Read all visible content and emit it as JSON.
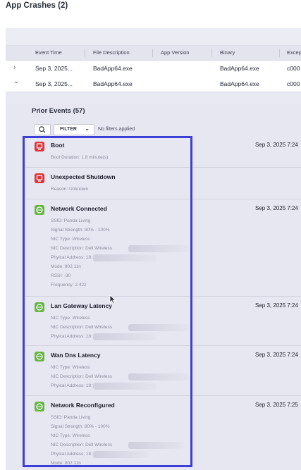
{
  "page": {
    "title": "App Crashes (2)"
  },
  "table": {
    "columns": [
      "Event Time",
      "File Description",
      "App Version",
      "Binary",
      "Excep"
    ],
    "rows": [
      {
        "chevron": "›",
        "event_time": "Sep 3, 2025...",
        "file_description": "BadApp64.exe",
        "app_version": "",
        "binary": "BadApp64.exe",
        "exception": "c000"
      },
      {
        "chevron": "⌄",
        "event_time": "Sep 3, 2025...",
        "file_description": "BadApp64.exe",
        "app_version": "",
        "binary": "BadApp64.exe",
        "exception": "c000"
      }
    ]
  },
  "prior_events": {
    "title": "Prior Events (57)",
    "filter_label": "FILTER",
    "filter_status": "No filters applied",
    "events": [
      {
        "icon": "power-icon",
        "color": "#d9353a",
        "name": "Boot",
        "time": "Sep 3, 2025 7:24",
        "details": [
          "Boot Duration:  1.8 minute(s)"
        ]
      },
      {
        "icon": "power-icon",
        "color": "#d9353a",
        "name": "Unexpected Shutdown",
        "time": "",
        "details": [
          "Reason:  Unknown"
        ]
      },
      {
        "icon": "network-icon",
        "color": "#67b545",
        "name": "Network Connected",
        "time": "Sep 3, 2025 7:24",
        "details": [
          "SSID:  Panda Living",
          "Signal Strength:  80% - 100%",
          "NIC Type:  Wireless",
          "NIC Description:  Dell Wireless",
          "Phyical Address:  18:",
          "Mode:  802.11n",
          "RSSI:  -30",
          "Frequency:  2.422"
        ]
      },
      {
        "icon": "network-icon",
        "color": "#67b545",
        "name": "Lan Gateway Latency",
        "time": "Sep 3, 2025 7:24",
        "details": [
          "NIC Type:  Wireless",
          "NIC Description:  Dell Wireless",
          "Phyical Address:  18:"
        ]
      },
      {
        "icon": "network-icon",
        "color": "#67b545",
        "name": "Wan Dns Latency",
        "time": "Sep 3, 2025 7:24",
        "details": [
          "NIC Type:  Wireless",
          "NIC Description:  Dell Wireless",
          "Phyical Address:  18:"
        ]
      },
      {
        "icon": "network-icon",
        "color": "#67b545",
        "name": "Network Reconfigured",
        "time": "Sep 3, 2025 7:25",
        "details": [
          "SSID:  Panda Living",
          "Signal Strength:  80% - 100%",
          "NIC Type:  Wireless",
          "NIC Description:  Dell Wireless",
          "Phyical Address:  18:",
          "Mode:  802.11n"
        ]
      }
    ]
  },
  "colors": {
    "highlight": "#3d3fd6",
    "panel_bg": "#e9e9f3"
  }
}
